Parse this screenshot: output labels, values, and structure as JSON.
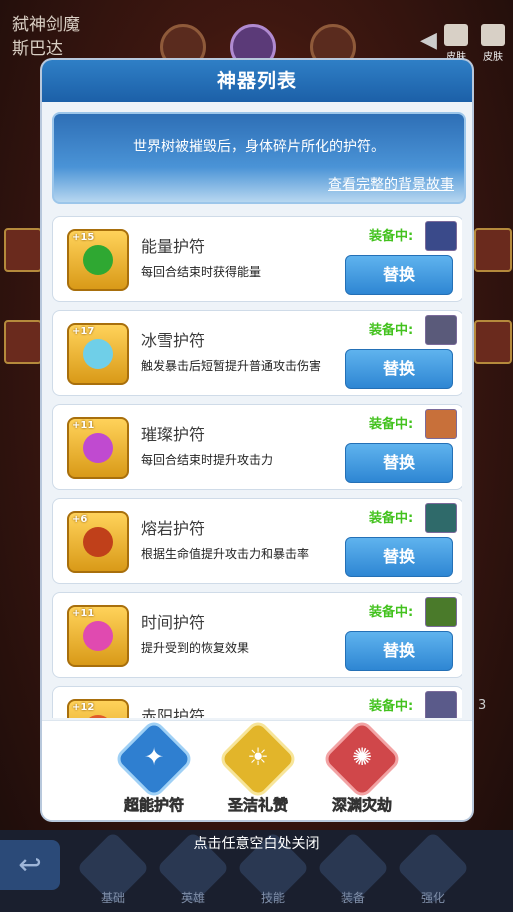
{
  "background": {
    "hero_name": "弑神剑魔",
    "hero_title": "斯巴达",
    "top_right_buttons": [
      {
        "label": "皮肤",
        "icon": "skin-icon"
      },
      {
        "label": "皮肤",
        "icon": "shirt-icon"
      }
    ],
    "bottom_nav": [
      {
        "label": "基础",
        "icon": "base-icon"
      },
      {
        "label": "英雄",
        "icon": "hero-icon"
      },
      {
        "label": "技能",
        "icon": "skill-icon"
      },
      {
        "label": "装备",
        "icon": "equip-icon"
      },
      {
        "label": "强化",
        "icon": "enhance-icon"
      }
    ],
    "side_number": "3"
  },
  "modal": {
    "title": "神器列表",
    "description": "世界树被摧毁后，身体碎片所化的护符。",
    "story_link": "查看完整的背景故事",
    "equipped_label": "装备中:",
    "replace_label": "替换",
    "items": [
      {
        "name": "能量护符",
        "level": "+15",
        "desc": "每回合结束时获得能量",
        "gem_color": "#2fa832",
        "thumb_color": "#3a4a8a"
      },
      {
        "name": "冰雪护符",
        "level": "+17",
        "desc": "触发暴击后短暂提升普通攻击伤害",
        "gem_color": "#6fcfe8",
        "thumb_color": "#5a5a7a"
      },
      {
        "name": "璀璨护符",
        "level": "+11",
        "desc": "每回合结束时提升攻击力",
        "gem_color": "#c04ad0",
        "thumb_color": "#c8703a"
      },
      {
        "name": "熔岩护符",
        "level": "+6",
        "desc": "根据生命值提升攻击力和暴击率",
        "gem_color": "#c0401a",
        "thumb_color": "#2f6a6a"
      },
      {
        "name": "时间护符",
        "level": "+11",
        "desc": "提升受到的恢复效果",
        "gem_color": "#e04ab0",
        "thumb_color": "#4a7a2a"
      },
      {
        "name": "赤阳护符",
        "level": "+12",
        "desc": "",
        "gem_color": "#e05a2a",
        "thumb_color": "#5a5a8a"
      }
    ],
    "categories": [
      {
        "label": "超能护符",
        "color": "#2f7fd0",
        "glyph": "✦"
      },
      {
        "label": "圣洁礼赞",
        "color": "#e2b52a",
        "glyph": "☀"
      },
      {
        "label": "深渊灾劫",
        "color": "#d0474a",
        "glyph": "✺"
      }
    ]
  },
  "close_hint": "点击任意空白处关闭"
}
